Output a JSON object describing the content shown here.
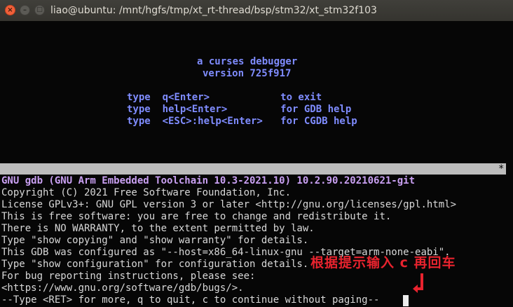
{
  "window": {
    "title": "liao@ubuntu: /mnt/hgfs/tmp/xt_rt-thread/bsp/stm32/xt_stm32f103",
    "buttons": {
      "close": "×",
      "minimize": "–",
      "maximize": "□"
    }
  },
  "splash": {
    "lines": [
      "a curses debugger",
      "version 725f917"
    ],
    "help": [
      "type  q<Enter>            to exit",
      "type  help<Enter>         for GDB help",
      "type  <ESC>:help<Enter>   for CGDB help"
    ]
  },
  "status_bar": {
    "marker": "*"
  },
  "gdb_output": [
    "GNU gdb (GNU Arm Embedded Toolchain 10.3-2021.10) 10.2.90.20210621-git",
    "Copyright (C) 2021 Free Software Foundation, Inc.",
    "License GPLv3+: GNU GPL version 3 or later <http://gnu.org/licenses/gpl.html>",
    "This is free software: you are free to change and redistribute it.",
    "There is NO WARRANTY, to the extent permitted by law.",
    "Type \"show copying\" and \"show warranty\" for details.",
    "This GDB was configured as \"--host=x86_64-linux-gnu --target=arm-none-eabi\".",
    "Type \"show configuration\" for configuration details.",
    "For bug reporting instructions, please see:",
    "<https://www.gnu.org/software/gdb/bugs/>.",
    "--Type <RET> for more, q to quit, c to continue without paging--"
  ],
  "annotation": {
    "text": "根据提示输入 c 再回车",
    "color": "#e8232e"
  },
  "colors": {
    "banner": "#7f8cff",
    "gdb_title": "#c9a0f2",
    "text": "#d8d8d8",
    "background": "#060606"
  }
}
